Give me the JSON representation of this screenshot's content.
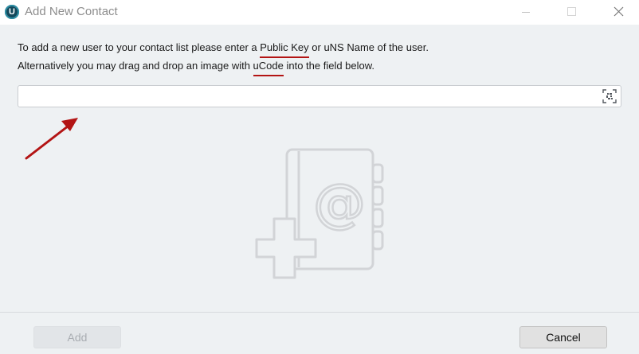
{
  "window": {
    "title": "Add New Contact",
    "app_icon_letter": "U"
  },
  "description": {
    "line1_part1": "To add a new user to your contact list please enter a ",
    "line1_highlight": "Public Key",
    "line1_part2": " or uNS Name of the user.",
    "line2_part1": "Alternatively you may drag and drop an image with ",
    "line2_highlight": "uCode",
    "line2_part2": " into the field below."
  },
  "input": {
    "value": "",
    "placeholder": "",
    "scan_icon": "scan-qr-icon"
  },
  "illustration": {
    "icon": "address-book-add-icon",
    "glyph": "@"
  },
  "buttons": {
    "add_label": "Add",
    "add_disabled": true,
    "cancel_label": "Cancel"
  },
  "colors": {
    "window_bg": "#eef1f3",
    "annotation_red": "#b31414",
    "illustration_gray": "#d2d4d7"
  }
}
